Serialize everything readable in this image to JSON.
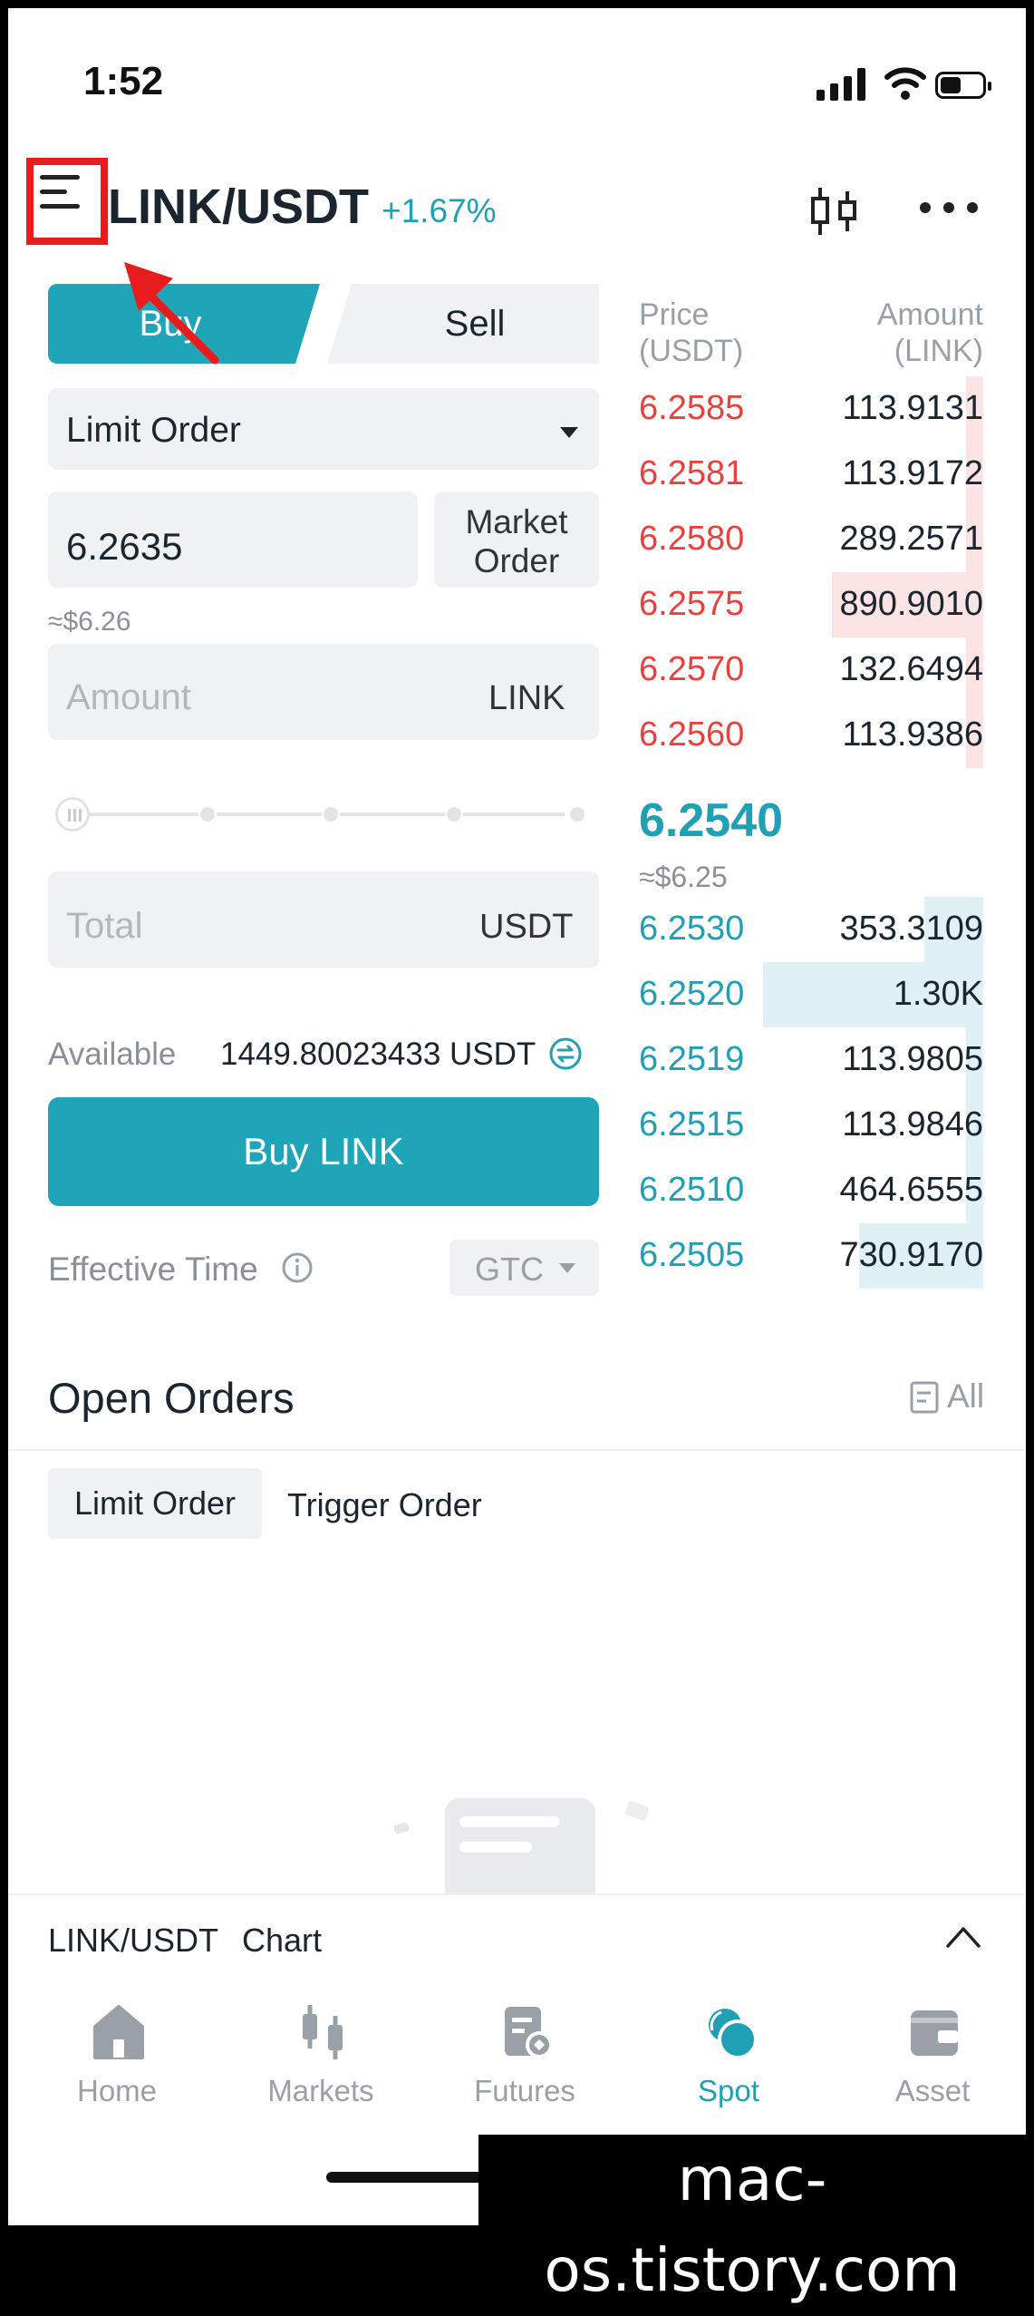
{
  "status_bar": {
    "time": "1:52"
  },
  "header": {
    "pair": "LINK/USDT",
    "change": "+1.67%"
  },
  "trade_form": {
    "tabs": {
      "buy": "Buy",
      "sell": "Sell"
    },
    "order_type": "Limit Order",
    "price_value": "6.2635",
    "market_order_label": "Market Order",
    "price_approx": "≈$6.26",
    "amount_placeholder": "Amount",
    "amount_unit": "LINK",
    "total_placeholder": "Total",
    "total_unit": "USDT",
    "available_label": "Available",
    "available_value": "1449.80023433 USDT",
    "buy_button": "Buy LINK",
    "effective_time_label": "Effective Time",
    "time_in_force": "GTC"
  },
  "order_book": {
    "price_header": "Price\n(USDT)",
    "amount_header": "Amount\n(LINK)",
    "asks": [
      {
        "price": "6.2585",
        "amount": "113.9131",
        "depth": 0.05
      },
      {
        "price": "6.2581",
        "amount": "113.9172",
        "depth": 0.05
      },
      {
        "price": "6.2580",
        "amount": "289.2571",
        "depth": 0.05
      },
      {
        "price": "6.2575",
        "amount": "890.9010",
        "depth": 0.44
      },
      {
        "price": "6.2570",
        "amount": "132.6494",
        "depth": 0.05
      },
      {
        "price": "6.2560",
        "amount": "113.9386",
        "depth": 0.05
      }
    ],
    "last_price": "6.2540",
    "last_price_approx": "≈$6.25",
    "bids": [
      {
        "price": "6.2530",
        "amount": "353.3109",
        "depth": 0.17
      },
      {
        "price": "6.2520",
        "amount": "1.30K",
        "depth": 0.64
      },
      {
        "price": "6.2519",
        "amount": "113.9805",
        "depth": 0.05
      },
      {
        "price": "6.2515",
        "amount": "113.9846",
        "depth": 0.05
      },
      {
        "price": "6.2510",
        "amount": "464.6555",
        "depth": 0.05
      },
      {
        "price": "6.2505",
        "amount": "730.9170",
        "depth": 0.36
      }
    ]
  },
  "open_orders": {
    "title": "Open Orders",
    "all_label": "All",
    "tabs": [
      "Limit Order",
      "Trigger Order"
    ]
  },
  "chart_bar": {
    "pair": "LINK/USDT",
    "label": "Chart"
  },
  "tabbar": {
    "items": [
      {
        "label": "Home",
        "icon": "home-icon"
      },
      {
        "label": "Markets",
        "icon": "markets-icon"
      },
      {
        "label": "Futures",
        "icon": "futures-icon"
      },
      {
        "label": "Spot",
        "icon": "spot-icon",
        "active": true
      },
      {
        "label": "Asset",
        "icon": "wallet-icon"
      }
    ]
  },
  "watermark": "mac-os.tistory.com",
  "colors": {
    "accent": "#20a4b8",
    "ask": "#e9423e",
    "highlight": "#e81c1c"
  }
}
